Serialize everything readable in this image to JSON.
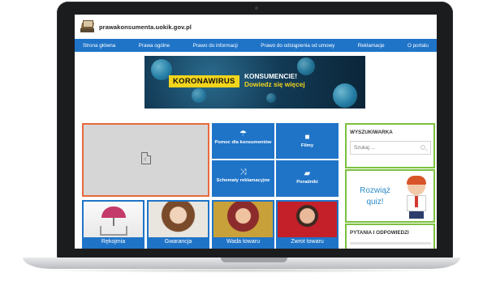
{
  "site": {
    "url": "prawakonsumenta.uokik.gov.pl",
    "accent": "#1f74c8",
    "highlight": "#e86a3c",
    "sidebar_border": "#7cc041"
  },
  "nav": [
    {
      "label": "Strona główna"
    },
    {
      "label": "Prawa ogólne"
    },
    {
      "label": "Prawo do informacji"
    },
    {
      "label": "Prawo do odstąpienia od umowy"
    },
    {
      "label": "Reklamacje"
    },
    {
      "label": "O portalu"
    }
  ],
  "banner": {
    "tag": "KORONAWIRUS",
    "line1": "KONSUMENCIE!",
    "line2": "Dowiedz się więcej"
  },
  "tiles": [
    {
      "label": "Pomoc dla konsumentów",
      "icon": "umbrella-icon"
    },
    {
      "label": "Filmy",
      "icon": "video-camera-icon"
    },
    {
      "label": "Schematy reklamacyjne",
      "icon": "shuffle-icon"
    },
    {
      "label": "Poradniki",
      "icon": "book-icon"
    }
  ],
  "photo_tiles": [
    {
      "label": "Rękojmia"
    },
    {
      "label": "Gwarancja"
    },
    {
      "label": "Wada towaru"
    },
    {
      "label": "Zwrot towaru"
    }
  ],
  "sidebar": {
    "search_title": "WYSZUKIWARKA",
    "search_placeholder": "Szukaj ...",
    "quiz_text": "Rozwiąż quiz!",
    "faq_title": "PYTANIA I ODPOWIEDZI"
  }
}
